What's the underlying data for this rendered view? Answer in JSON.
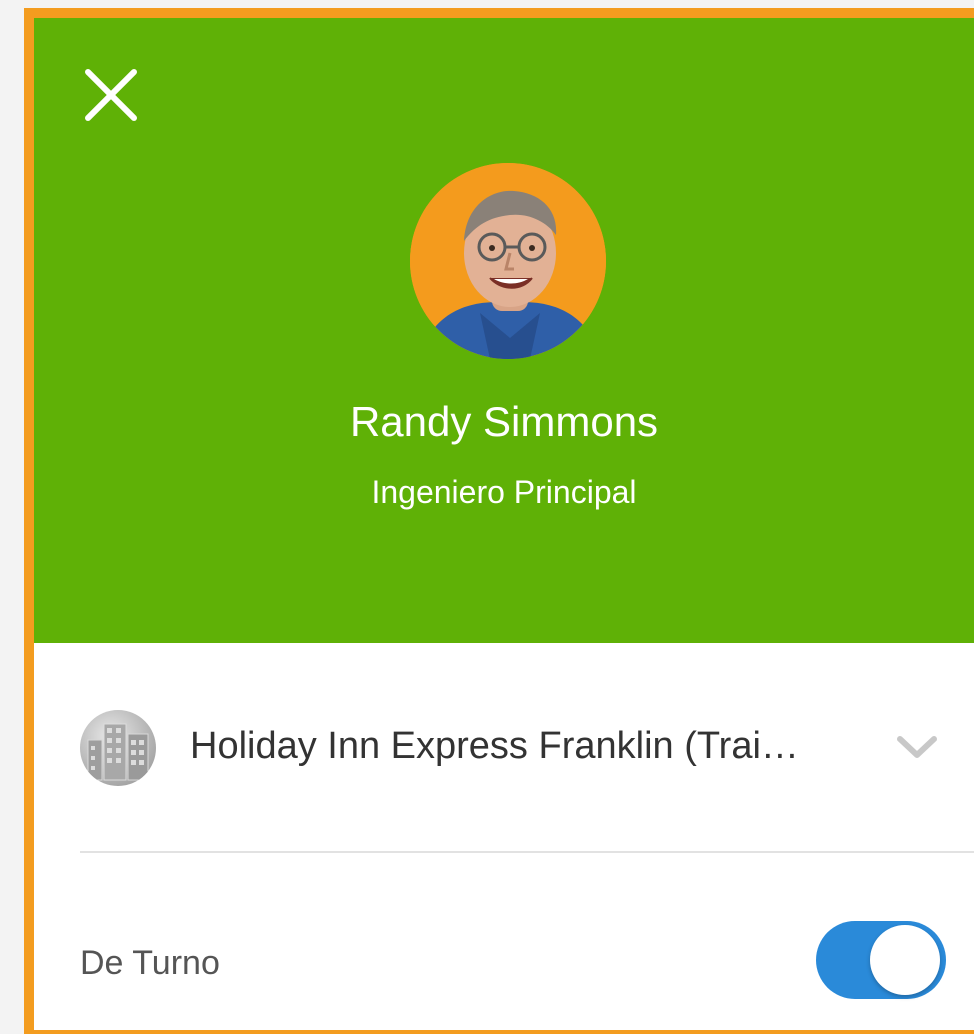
{
  "header": {
    "close_icon": "close-icon",
    "name": "Randy Simmons",
    "role": "Ingeniero Principal",
    "background_color": "#5fb106",
    "avatar_background": "#f49b1d"
  },
  "property": {
    "icon": "building-icon",
    "name": "Holiday Inn Express Franklin (Trai…",
    "chevron_icon": "chevron-down-icon"
  },
  "duty": {
    "label": "De Turno",
    "toggle_on": true,
    "toggle_color": "#2a8ad9"
  },
  "frame": {
    "border_color": "#f39c1f"
  }
}
